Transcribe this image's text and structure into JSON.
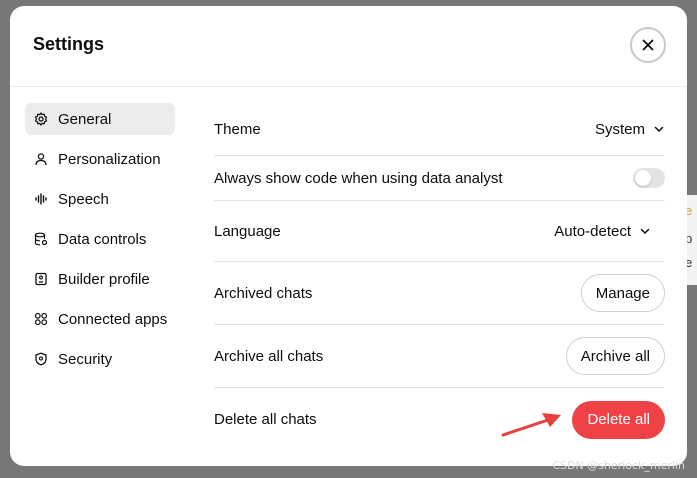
{
  "dialog": {
    "title": "Settings"
  },
  "sidebar": {
    "items": [
      {
        "label": "General",
        "icon": "gear-icon",
        "active": true
      },
      {
        "label": "Personalization",
        "icon": "person-icon"
      },
      {
        "label": "Speech",
        "icon": "waveform-icon"
      },
      {
        "label": "Data controls",
        "icon": "database-icon"
      },
      {
        "label": "Builder profile",
        "icon": "id-card-icon"
      },
      {
        "label": "Connected apps",
        "icon": "apps-grid-icon"
      },
      {
        "label": "Security",
        "icon": "shield-icon"
      }
    ]
  },
  "general": {
    "theme": {
      "label": "Theme",
      "value": "System"
    },
    "show_code": {
      "label": "Always show code when using data analyst",
      "enabled": false
    },
    "language": {
      "label": "Language",
      "value": "Auto-detect"
    },
    "archived_chats": {
      "label": "Archived chats",
      "button": "Manage"
    },
    "archive_all": {
      "label": "Archive all chats",
      "button": "Archive all"
    },
    "delete_all": {
      "label": "Delete all chats",
      "button": "Delete all"
    }
  },
  "colors": {
    "danger": "#ef4146",
    "annotation_arrow": "#e8403a",
    "active_nav": "#ececec"
  },
  "background": {
    "partial_glyphs": [
      "e",
      "p",
      "e"
    ]
  },
  "watermark": "CSDN @sherlock_merlin"
}
